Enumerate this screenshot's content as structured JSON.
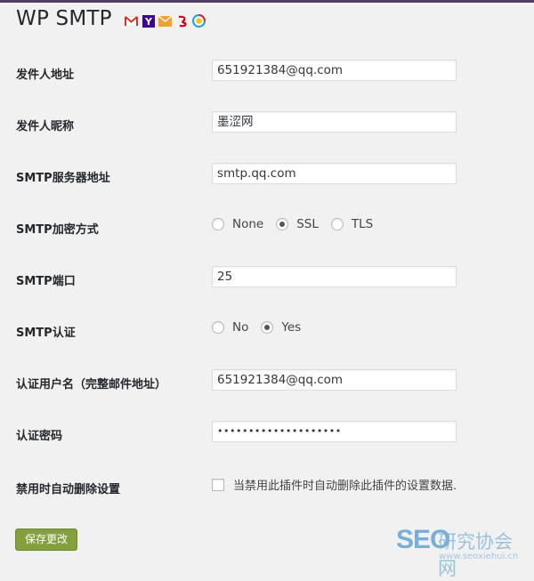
{
  "page": {
    "title": "WP SMTP"
  },
  "provider_icons": [
    "gmail-icon",
    "yahoo-icon",
    "outlook-icon",
    "163-mail-icon",
    "qq-mail-icon"
  ],
  "form": {
    "from_address": {
      "label": "发件人地址",
      "value": "651921384@qq.com"
    },
    "from_name": {
      "label": "发件人昵称",
      "value": "墨涩网"
    },
    "smtp_host": {
      "label": "SMTP服务器地址",
      "value": "smtp.qq.com"
    },
    "smtp_secure": {
      "label": "SMTP加密方式",
      "options": [
        "None",
        "SSL",
        "TLS"
      ],
      "selected": "SSL"
    },
    "smtp_port": {
      "label": "SMTP端口",
      "value": "25"
    },
    "smtp_auth": {
      "label": "SMTP认证",
      "options": [
        "No",
        "Yes"
      ],
      "selected": "Yes"
    },
    "username": {
      "label": "认证用户名（完整邮件地址）",
      "value": "651921384@qq.com"
    },
    "password": {
      "label": "认证密码",
      "value": "••••••••••••••••••••"
    },
    "delete_on_uninstall": {
      "label": "禁用时自动删除设置",
      "checkbox_label": "当禁用此插件时自动删除此插件的设置数据.",
      "checked": false
    }
  },
  "buttons": {
    "save": "保存更改"
  },
  "watermark": {
    "seo": "SEO",
    "cn": "研究协会网",
    "url": "www.seoxiehui.cn"
  }
}
